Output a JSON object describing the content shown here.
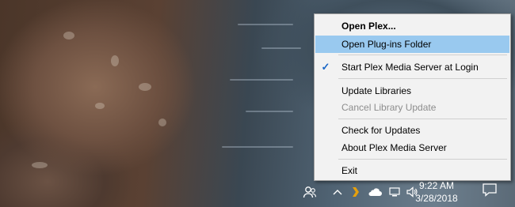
{
  "context_menu": {
    "items": [
      {
        "label": "Open Plex...",
        "bold": true
      },
      {
        "label": "Open Plug-ins Folder",
        "highlighted": true
      },
      {
        "label": "Start Plex Media Server at Login",
        "checked": true
      },
      {
        "label": "Update Libraries"
      },
      {
        "label": "Cancel Library Update",
        "disabled": true
      },
      {
        "label": "Check for Updates"
      },
      {
        "label": "About Plex Media Server"
      },
      {
        "label": "Exit"
      }
    ]
  },
  "taskbar": {
    "icons": [
      "people-icon",
      "chevron-up-icon",
      "plex-tray-icon",
      "onedrive-icon",
      "network-icon",
      "volume-icon",
      "action-center-icon"
    ],
    "clock": {
      "time": "9:22 AM",
      "date": "3/28/2018"
    }
  },
  "colors": {
    "menu_background": "#f2f2f2",
    "highlight": "#99c9ef",
    "plex_accent": "#e5a00d",
    "check": "#1a67c7"
  }
}
